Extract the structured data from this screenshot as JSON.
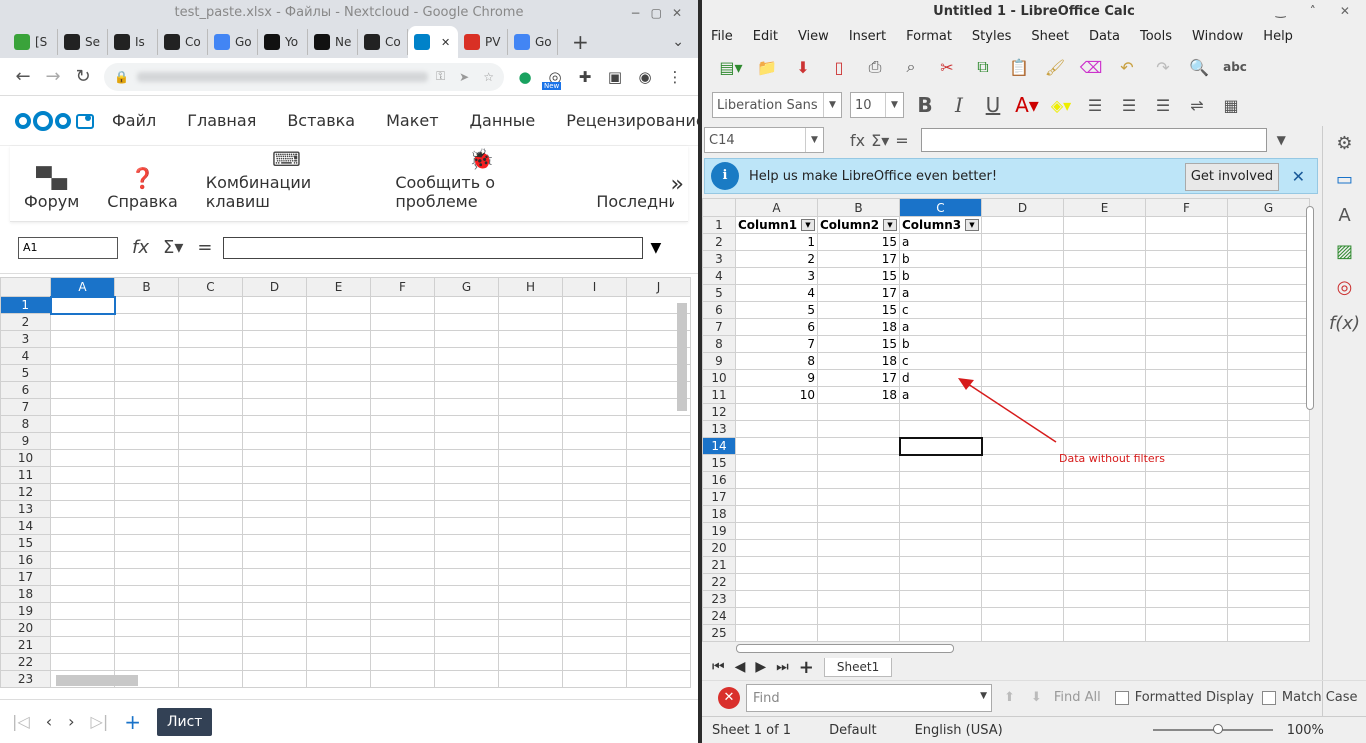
{
  "chrome": {
    "title": "test_paste.xlsx - Файлы - Nextcloud - Google Chrome",
    "tabs": [
      {
        "label": "[S",
        "icon": "nextcloud-icon",
        "color": "#3aa33a"
      },
      {
        "label": "Se",
        "icon": "github-icon",
        "color": "#222"
      },
      {
        "label": "Is",
        "icon": "github-icon",
        "color": "#222"
      },
      {
        "label": "Co",
        "icon": "github-icon",
        "color": "#222"
      },
      {
        "label": "Go",
        "icon": "google-translate-icon",
        "color": "#4285f4"
      },
      {
        "label": "Yo",
        "icon": "youtrack-icon",
        "color": "#111"
      },
      {
        "label": "Ne",
        "icon": "youtrack-icon",
        "color": "#111"
      },
      {
        "label": "Co",
        "icon": "github-icon",
        "color": "#222"
      },
      {
        "label": "",
        "icon": "nextcloud-icon",
        "color": "#0082c9",
        "active": true
      },
      {
        "label": "PV",
        "icon": "gmail-icon",
        "color": "#d93025"
      },
      {
        "label": "Go",
        "icon": "google-translate-icon",
        "color": "#4285f4"
      }
    ],
    "new_badge": "New"
  },
  "nextcloud": {
    "menu": [
      "Файл",
      "Главная",
      "Вставка",
      "Макет",
      "Данные",
      "Рецензирование"
    ],
    "toolbar": [
      {
        "label": "Форум",
        "icon": "forum-icon"
      },
      {
        "label": "Справка",
        "icon": "help-icon"
      },
      {
        "label": "Комбинации клавиш",
        "icon": "keyboard-icon"
      },
      {
        "label": "Сообщить о проблеме",
        "icon": "bug-icon"
      },
      {
        "label": "Последние",
        "icon": "recent-icon"
      }
    ],
    "namebox": "A1",
    "columns": [
      "A",
      "B",
      "C",
      "D",
      "E",
      "F",
      "G",
      "H",
      "I",
      "J"
    ],
    "rows": [
      "1",
      "2",
      "3",
      "4",
      "5",
      "6",
      "7",
      "8",
      "9",
      "10",
      "11",
      "12",
      "13",
      "14",
      "15",
      "16",
      "17",
      "18",
      "19",
      "20",
      "21",
      "22",
      "23"
    ],
    "sheet_tab": "Лист"
  },
  "libreoffice": {
    "title": "Untitled 1 - LibreOffice Calc",
    "menu": [
      "File",
      "Edit",
      "View",
      "Insert",
      "Format",
      "Styles",
      "Sheet",
      "Data",
      "Tools",
      "Window",
      "Help"
    ],
    "font_name": "Liberation Sans",
    "font_size": "10",
    "namebox": "C14",
    "info_text": "Help us make LibreOffice even better!",
    "info_button": "Get involved",
    "columns": [
      "A",
      "B",
      "C",
      "D",
      "E",
      "F",
      "G"
    ],
    "rows": [
      [
        "Column1",
        "Column2",
        "Column3"
      ],
      [
        "1",
        "15",
        "a"
      ],
      [
        "2",
        "17",
        "b"
      ],
      [
        "3",
        "15",
        "b"
      ],
      [
        "4",
        "17",
        "a"
      ],
      [
        "5",
        "15",
        "c"
      ],
      [
        "6",
        "18",
        "a"
      ],
      [
        "7",
        "15",
        "b"
      ],
      [
        "8",
        "18",
        "c"
      ],
      [
        "9",
        "17",
        "d"
      ],
      [
        "10",
        "18",
        "a"
      ]
    ],
    "row_count": 25,
    "annotation": "Data without filters",
    "sheet_tab": "Sheet1",
    "find_placeholder": "Find",
    "find_all": "Find All",
    "formatted_display": "Formatted Display",
    "match_case": "Match Case",
    "status": {
      "sheet": "Sheet 1 of 1",
      "style": "Default",
      "language": "English (USA)",
      "zoom": "100%"
    }
  }
}
